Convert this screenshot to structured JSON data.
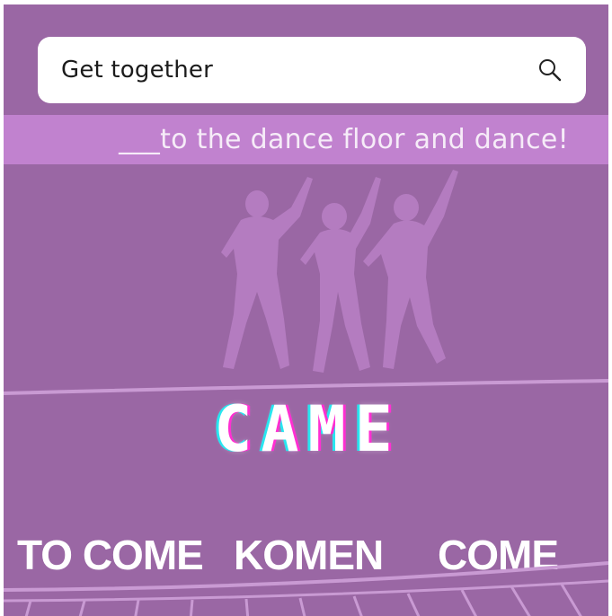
{
  "search": {
    "value": "Get together",
    "icon": "search-icon"
  },
  "prompt": {
    "text": "___to the dance floor and dance!"
  },
  "illustration": {
    "name": "three-dancers"
  },
  "word": {
    "text": "CAME"
  },
  "options": [
    {
      "label": "TO COME"
    },
    {
      "label": "KOMEN"
    },
    {
      "label": "COME"
    }
  ],
  "colors": {
    "background": "#9a67a4",
    "band": "#c182cf",
    "silhouette": "#b47cc0",
    "glitch_pink": "#ff2fd2",
    "glitch_cyan": "#28e6f0"
  }
}
